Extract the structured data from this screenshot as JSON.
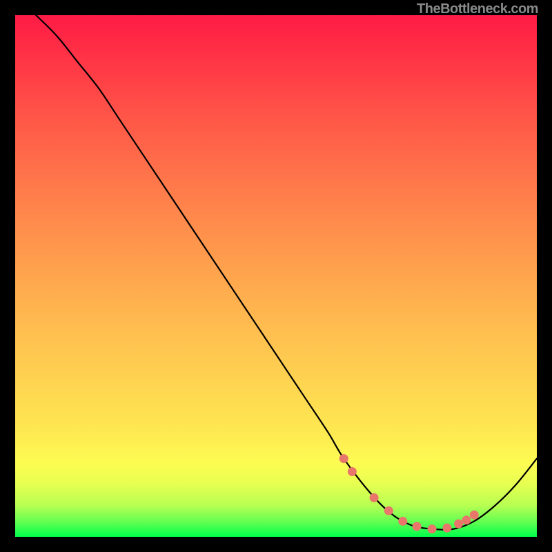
{
  "attribution": "TheBottleneck.com",
  "chart_data": {
    "type": "line",
    "title": "",
    "xlabel": "",
    "ylabel": "",
    "xlim": [
      0,
      100
    ],
    "ylim": [
      0,
      100
    ],
    "grid": false,
    "legend": false,
    "series": [
      {
        "name": "bottleneck-curve",
        "color": "#000000",
        "x": [
          4,
          8,
          12,
          16,
          20,
          24,
          28,
          32,
          36,
          40,
          44,
          48,
          52,
          56,
          60,
          63,
          68,
          72,
          76,
          80,
          84,
          88,
          92,
          96,
          100
        ],
        "values": [
          100,
          96,
          91,
          86,
          80,
          74,
          68,
          62,
          56,
          50,
          44,
          38,
          32,
          26,
          20,
          15,
          8.5,
          4.5,
          2.2,
          1.5,
          1.5,
          3.0,
          6.0,
          10,
          15
        ]
      }
    ],
    "markers": {
      "name": "highlight-dots",
      "color": "#e9766a",
      "radius_px": 6.5,
      "x": [
        63.0,
        64.6,
        68.8,
        71.6,
        74.3,
        77.0,
        79.9,
        82.8,
        85.0,
        86.5,
        88.0
      ],
      "y": [
        15.0,
        12.5,
        7.5,
        5.0,
        3.0,
        2.0,
        1.5,
        1.7,
        2.5,
        3.2,
        4.2
      ]
    }
  }
}
